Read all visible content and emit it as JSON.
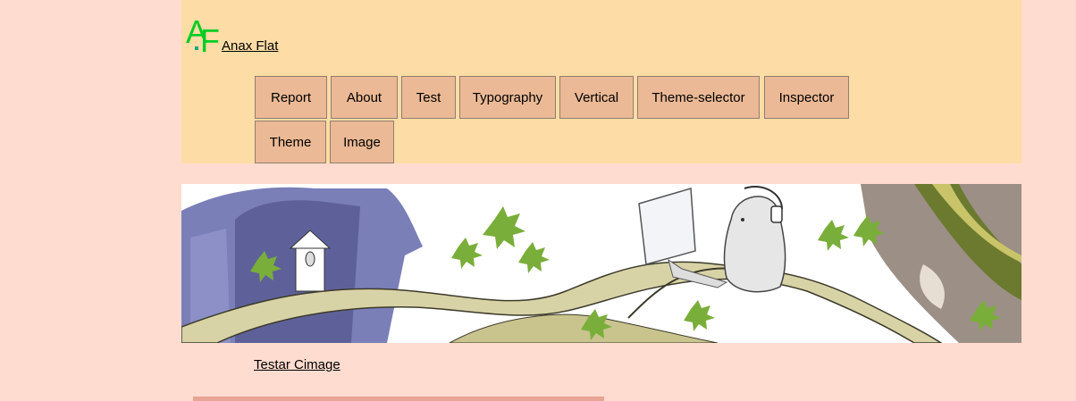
{
  "header": {
    "logo_text": "AF",
    "site_name": " Anax Flat"
  },
  "nav": {
    "items": [
      {
        "label": "Report"
      },
      {
        "label": "About"
      },
      {
        "label": "Test"
      },
      {
        "label": "Typography"
      },
      {
        "label": "Vertical"
      },
      {
        "label": "Theme-selector"
      },
      {
        "label": "Inspector"
      },
      {
        "label": "Theme"
      },
      {
        "label": "Image"
      }
    ]
  },
  "content": {
    "caption_link": "Testar Cimage"
  },
  "colors": {
    "page_bg": "#ffdccf",
    "header_bg": "#fddca5",
    "button_bg": "#ebb995",
    "logo": "#00cc22"
  }
}
